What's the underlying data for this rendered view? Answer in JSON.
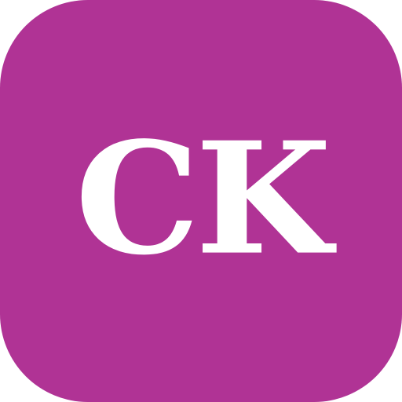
{
  "app_icon": {
    "monogram": "CK",
    "background_color": "#b03395",
    "text_color": "#ffffff"
  }
}
